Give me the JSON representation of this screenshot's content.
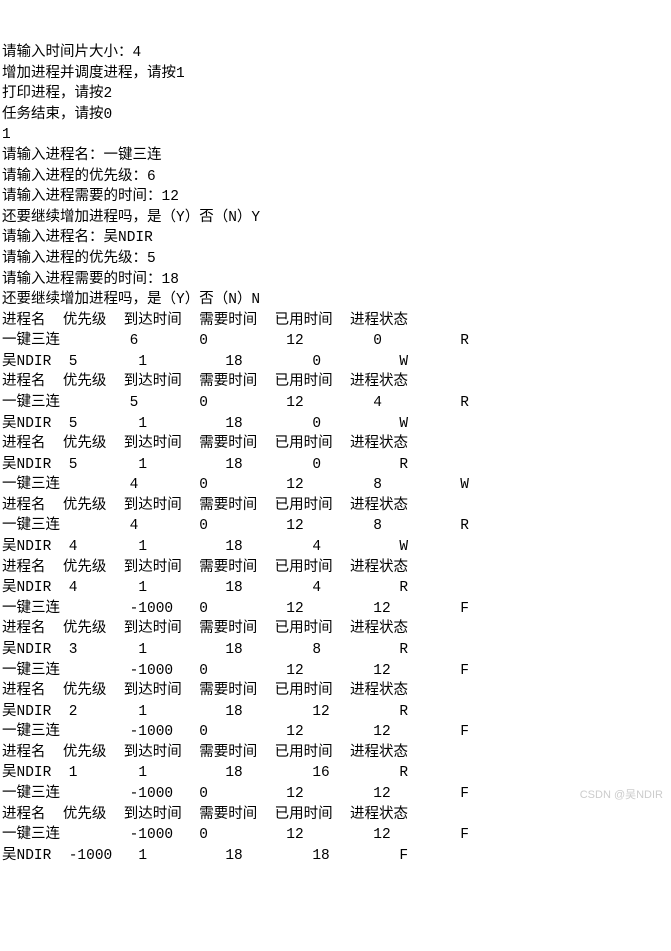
{
  "prompts": {
    "timeSlice": "请输入时间片大小：4",
    "addSchedule": "增加进程并调度进程，请按1",
    "printProcess": "打印进程，请按2",
    "endTask": "任务结束，请按0",
    "choice": "1",
    "procName1": "请输入进程名：一键三连",
    "priority1": "请输入进程的优先级：6",
    "time1": "请输入进程需要的时间：12",
    "continue1": "还要继续增加进程吗，是（Y）否（N）Y",
    "procName2": "请输入进程名：吴NDIR",
    "priority2": "请输入进程的优先级：5",
    "time2": "请输入进程需要的时间：18",
    "continue2": "还要继续增加进程吗，是（Y）否（N）N"
  },
  "header": "进程名  优先级  到达时间  需要时间  已用时间  进程状态",
  "rows": [
    "一键三连        6       0         12        0         R",
    "吴NDIR  5       1         18        0         W",
    "进程名  优先级  到达时间  需要时间  已用时间  进程状态",
    "一键三连        5       0         12        4         R",
    "吴NDIR  5       1         18        0         W",
    "进程名  优先级  到达时间  需要时间  已用时间  进程状态",
    "吴NDIR  5       1         18        0         R",
    "一键三连        4       0         12        8         W",
    "进程名  优先级  到达时间  需要时间  已用时间  进程状态",
    "一键三连        4       0         12        8         R",
    "吴NDIR  4       1         18        4         W",
    "进程名  优先级  到达时间  需要时间  已用时间  进程状态",
    "吴NDIR  4       1         18        4         R",
    "一键三连        -1000   0         12        12        F",
    "进程名  优先级  到达时间  需要时间  已用时间  进程状态",
    "吴NDIR  3       1         18        8         R",
    "一键三连        -1000   0         12        12        F",
    "进程名  优先级  到达时间  需要时间  已用时间  进程状态",
    "吴NDIR  2       1         18        12        R",
    "一键三连        -1000   0         12        12        F",
    "进程名  优先级  到达时间  需要时间  已用时间  进程状态",
    "吴NDIR  1       1         18        16        R",
    "一键三连        -1000   0         12        12        F",
    "进程名  优先级  到达时间  需要时间  已用时间  进程状态",
    "一键三连        -1000   0         12        12        F",
    "吴NDIR  -1000   1         18        18        F"
  ],
  "watermark": "CSDN @吴NDIR",
  "chart_data": {
    "type": "table",
    "title": "Process Scheduling Simulation (Round-Robin with Priority)",
    "timeSliceSize": 4,
    "menuChoice": 1,
    "processes_input": [
      {
        "name": "一键三连",
        "priority": 6,
        "neededTime": 12,
        "continue": "Y"
      },
      {
        "name": "吴NDIR",
        "priority": 5,
        "neededTime": 18,
        "continue": "N"
      }
    ],
    "columns": [
      "进程名",
      "优先级",
      "到达时间",
      "需要时间",
      "已用时间",
      "进程状态"
    ],
    "snapshots": [
      [
        {
          "name": "一键三连",
          "priority": 6,
          "arrive": 0,
          "need": 12,
          "used": 0,
          "state": "R"
        },
        {
          "name": "吴NDIR",
          "priority": 5,
          "arrive": 1,
          "need": 18,
          "used": 0,
          "state": "W"
        }
      ],
      [
        {
          "name": "一键三连",
          "priority": 5,
          "arrive": 0,
          "need": 12,
          "used": 4,
          "state": "R"
        },
        {
          "name": "吴NDIR",
          "priority": 5,
          "arrive": 1,
          "need": 18,
          "used": 0,
          "state": "W"
        }
      ],
      [
        {
          "name": "吴NDIR",
          "priority": 5,
          "arrive": 1,
          "need": 18,
          "used": 0,
          "state": "R"
        },
        {
          "name": "一键三连",
          "priority": 4,
          "arrive": 0,
          "need": 12,
          "used": 8,
          "state": "W"
        }
      ],
      [
        {
          "name": "一键三连",
          "priority": 4,
          "arrive": 0,
          "need": 12,
          "used": 8,
          "state": "R"
        },
        {
          "name": "吴NDIR",
          "priority": 4,
          "arrive": 1,
          "need": 18,
          "used": 4,
          "state": "W"
        }
      ],
      [
        {
          "name": "吴NDIR",
          "priority": 4,
          "arrive": 1,
          "need": 18,
          "used": 4,
          "state": "R"
        },
        {
          "name": "一键三连",
          "priority": -1000,
          "arrive": 0,
          "need": 12,
          "used": 12,
          "state": "F"
        }
      ],
      [
        {
          "name": "吴NDIR",
          "priority": 3,
          "arrive": 1,
          "need": 18,
          "used": 8,
          "state": "R"
        },
        {
          "name": "一键三连",
          "priority": -1000,
          "arrive": 0,
          "need": 12,
          "used": 12,
          "state": "F"
        }
      ],
      [
        {
          "name": "吴NDIR",
          "priority": 2,
          "arrive": 1,
          "need": 18,
          "used": 12,
          "state": "R"
        },
        {
          "name": "一键三连",
          "priority": -1000,
          "arrive": 0,
          "need": 12,
          "used": 12,
          "state": "F"
        }
      ],
      [
        {
          "name": "吴NDIR",
          "priority": 1,
          "arrive": 1,
          "need": 18,
          "used": 16,
          "state": "R"
        },
        {
          "name": "一键三连",
          "priority": -1000,
          "arrive": 0,
          "need": 12,
          "used": 12,
          "state": "F"
        }
      ],
      [
        {
          "name": "一键三连",
          "priority": -1000,
          "arrive": 0,
          "need": 12,
          "used": 12,
          "state": "F"
        },
        {
          "name": "吴NDIR",
          "priority": -1000,
          "arrive": 1,
          "need": 18,
          "used": 18,
          "state": "F"
        }
      ]
    ]
  }
}
